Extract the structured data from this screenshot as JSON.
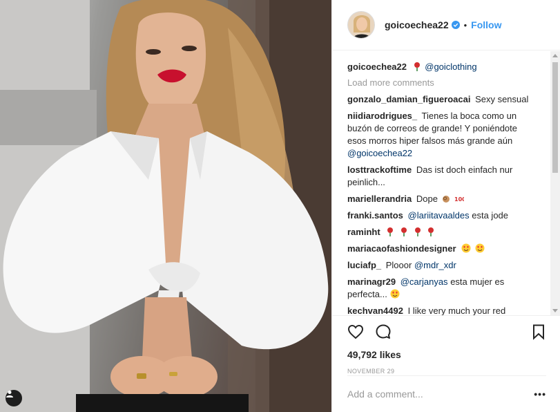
{
  "post": {
    "username": "goicoechea22",
    "follow_label": "Follow",
    "dot": "•",
    "likes": "49,792 likes",
    "date": "November 29",
    "add_comment_placeholder": "Add a comment...",
    "more_label": "•••"
  },
  "caption": {
    "author": "goicoechea22",
    "emoji": "rose",
    "mention": "@goiclothing"
  },
  "load_more": "Load more comments",
  "comments": [
    {
      "author": "gonzalo_damian_figueroacai",
      "text": "Sexy sensual"
    },
    {
      "author": "niidiarodrigues_",
      "text": "Tienes la boca como un buzón de correos de grande! Y poniéndote esos morros hiper falsos más grande aún",
      "mention": "@goicoechea22"
    },
    {
      "author": "losttrackoftime",
      "text": "Das ist doch einfach nur peinlich..."
    },
    {
      "author": "mariellerandria",
      "text": "Dope",
      "emoji": [
        "ok-hand-icon",
        "100-icon"
      ]
    },
    {
      "author": "franki.santos",
      "mention": "@lariitavaaldes",
      "text": "esta jode"
    },
    {
      "author": "raminht",
      "emoji": [
        "rose",
        "rose",
        "rose",
        "rose"
      ]
    },
    {
      "author": "mariacaofashiondesigner",
      "emoji": [
        "heart-eyes",
        "heart-eyes"
      ]
    },
    {
      "author": "luciafp_",
      "text": "Plooor",
      "mention": "@mdr_xdr"
    },
    {
      "author": "marinagr29",
      "mention": "@carjanyas",
      "text": "esta mujer es perfecta...",
      "emoji": [
        "heart-eyes"
      ]
    },
    {
      "author": "kechvan4492",
      "text": "I like very much your red"
    }
  ],
  "icons": {
    "like": "heart-icon",
    "comment": "comment-bubble-icon",
    "save": "bookmark-icon",
    "tag": "user-tag-icon",
    "verified": "verified-badge-icon"
  },
  "colors": {
    "accent": "#3897f0",
    "verified": "#3897f0",
    "mention": "#003569",
    "muted": "#999999"
  }
}
